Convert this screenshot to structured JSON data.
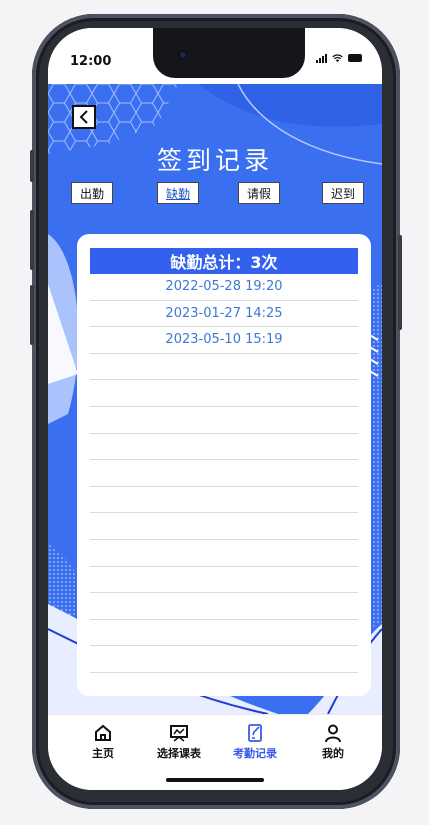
{
  "status_bar": {
    "time": "12:00"
  },
  "header": {
    "title": "签到记录",
    "back_icon": "chevron-left-icon"
  },
  "filter_tabs": [
    {
      "label": "出勤",
      "active": false
    },
    {
      "label": "缺勤",
      "active": true
    },
    {
      "label": "请假",
      "active": false
    },
    {
      "label": "迟到",
      "active": false
    }
  ],
  "record_card": {
    "summary": "缺勤总计：3次",
    "records": [
      "2022-05-28 19:20",
      "2023-01-27 14:25",
      "2023-05-10 15:19"
    ]
  },
  "bottom_nav": [
    {
      "label": "主页",
      "icon": "home-icon",
      "active": false
    },
    {
      "label": "选择课表",
      "icon": "schedule-icon",
      "active": false
    },
    {
      "label": "考勤记录",
      "icon": "attendance-icon",
      "active": true
    },
    {
      "label": "我的",
      "icon": "user-icon",
      "active": false
    }
  ],
  "colors": {
    "background_blue": "#3a6ff0",
    "header_bar": "#3361ee",
    "record_text": "#3c78d8",
    "active_nav": "#3a5be8"
  }
}
